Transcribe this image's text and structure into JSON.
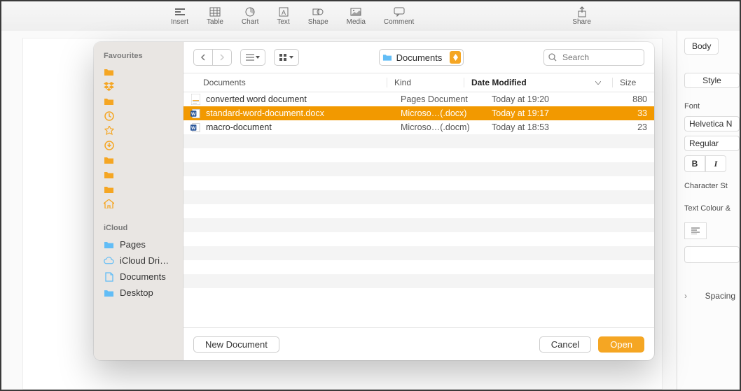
{
  "toolbar": {
    "items": [
      "Insert",
      "Table",
      "Chart",
      "Text",
      "Shape",
      "Media",
      "Comment"
    ],
    "share": "Share"
  },
  "inspector": {
    "tab": "Body",
    "style_btn": "Style",
    "font_label": "Font",
    "font_family": "Helvetica N",
    "font_style": "Regular",
    "bold": "B",
    "italic": "I",
    "char_styles": "Character St",
    "text_colour": "Text Colour &",
    "spacing": "Spacing"
  },
  "dialog": {
    "sidebar": {
      "fav_header": "Favourites",
      "icloud_header": "iCloud",
      "icloud_items": [
        "Pages",
        "iCloud Dri…",
        "Documents",
        "Desktop"
      ]
    },
    "location": "Documents",
    "search_placeholder": "Search",
    "columns": {
      "name": "Documents",
      "kind": "Kind",
      "date": "Date Modified",
      "size": "Size"
    },
    "files": [
      {
        "name": "converted word document",
        "kind": "Pages Document",
        "date": "Today at 19:20",
        "size": "880",
        "icon": "pages",
        "selected": false
      },
      {
        "name": "standard-word-document.docx",
        "kind": "Microso…(.docx)",
        "date": "Today at 19:17",
        "size": "33",
        "icon": "word",
        "selected": true
      },
      {
        "name": "macro-document",
        "kind": "Microso…(.docm)",
        "date": "Today at 18:53",
        "size": "23",
        "icon": "word",
        "selected": false
      }
    ],
    "buttons": {
      "new": "New Document",
      "cancel": "Cancel",
      "open": "Open"
    }
  }
}
